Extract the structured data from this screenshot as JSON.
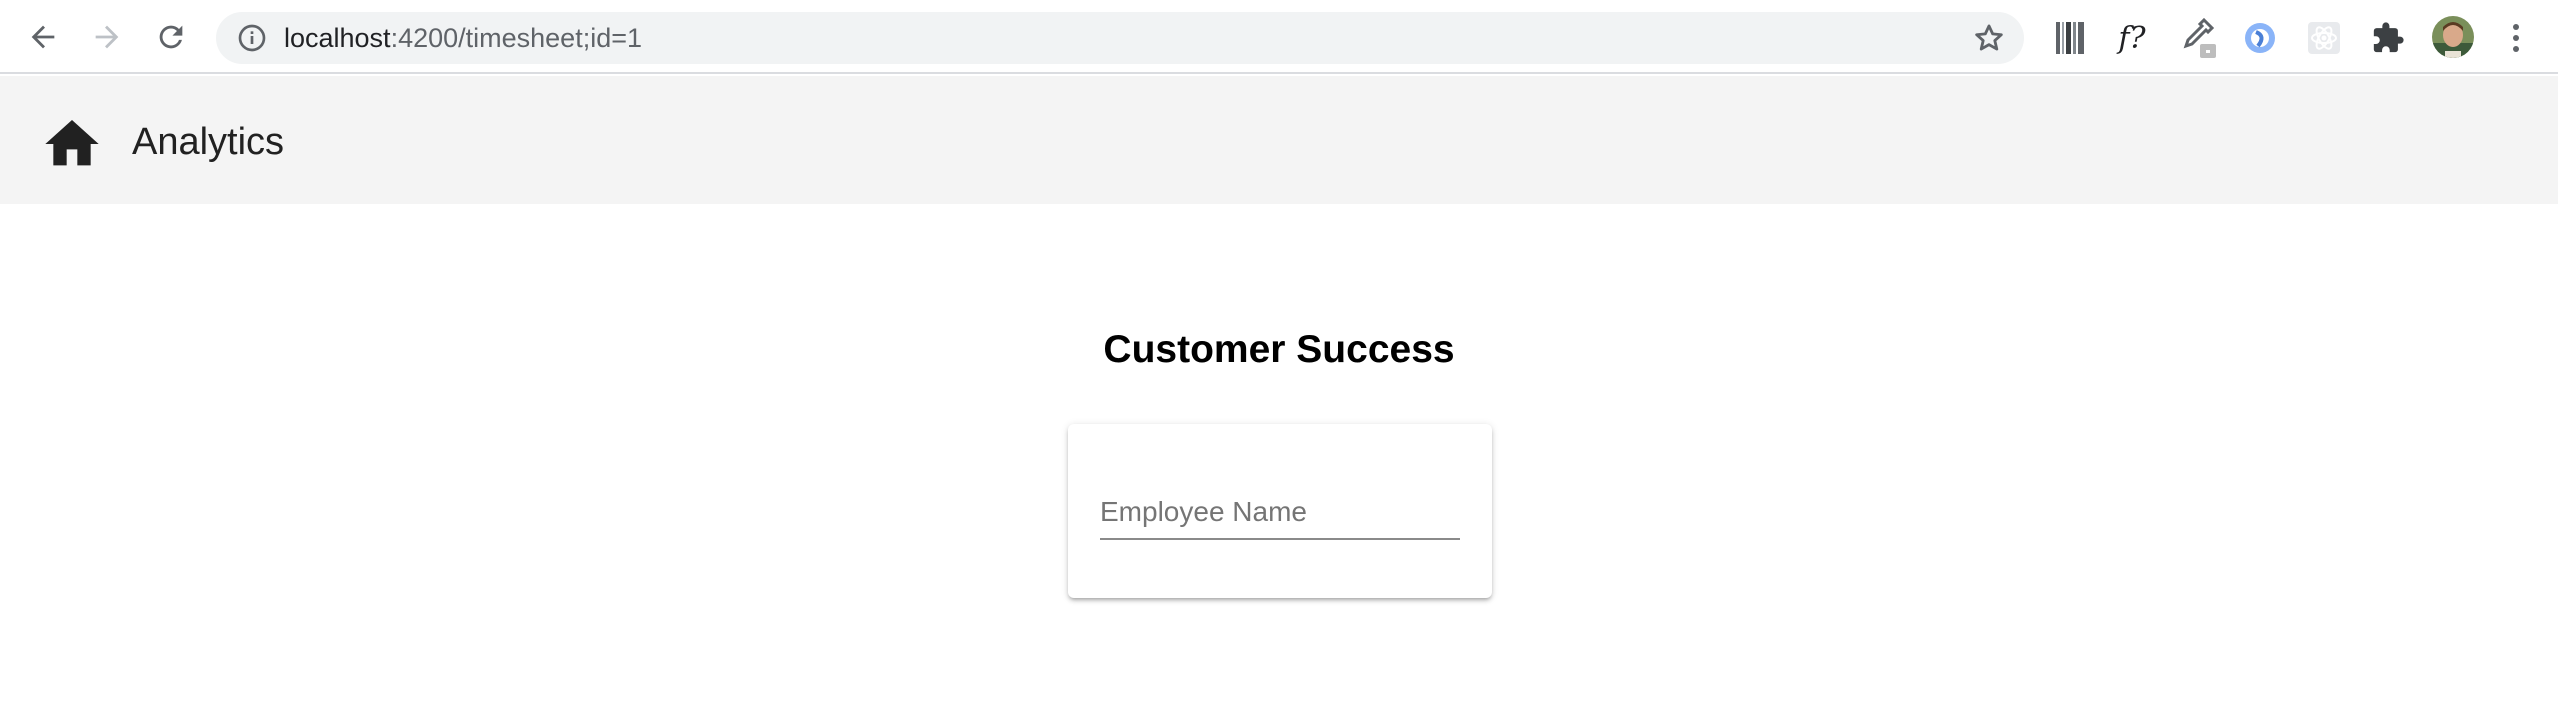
{
  "browser": {
    "url_host": "localhost",
    "url_rest": ":4200/timesheet;id=1",
    "extensions": [
      "barcode-extension-icon",
      "f-question-extension-icon",
      "eyedropper-extension-icon",
      "blue-circle-extension-icon",
      "react-devtools-icon",
      "puzzle-icon",
      "avatar"
    ],
    "f_extension_label": "f?"
  },
  "toolbar": {
    "title": "Analytics",
    "home_icon": "home-icon",
    "background": "#f4f4f4"
  },
  "main": {
    "heading": "Customer Success",
    "employee_field": {
      "placeholder": "Employee Name",
      "value": ""
    }
  }
}
